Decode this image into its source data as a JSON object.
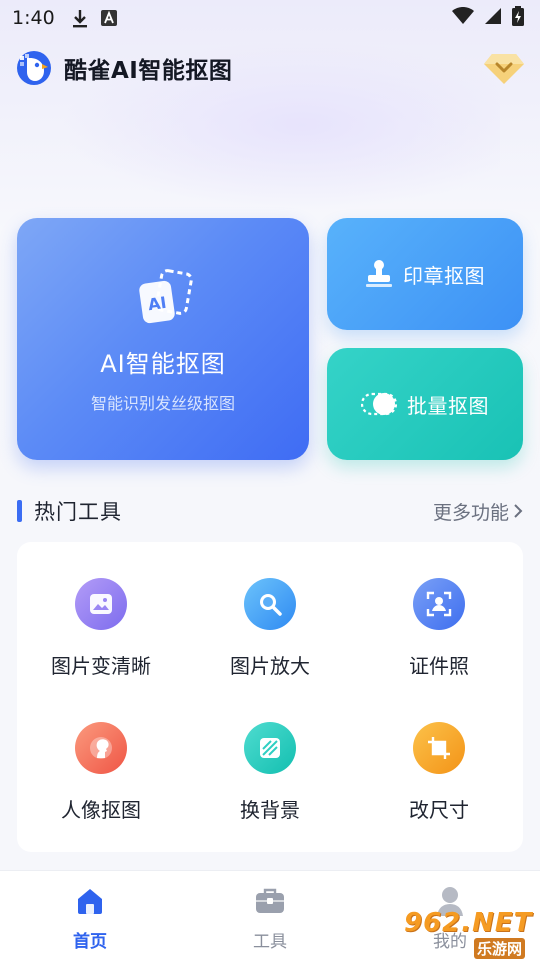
{
  "status_bar": {
    "time": "1:40",
    "left_icons": [
      "download-icon",
      "text-a-icon"
    ],
    "right_icons": [
      "wifi-icon",
      "cellular-icon",
      "battery-icon"
    ]
  },
  "header": {
    "app_title": "酷雀AI智能抠图",
    "logo": "bird-logo-icon",
    "vip_icon": "vip-diamond-icon"
  },
  "feature_cards": {
    "ai": {
      "title": "AI智能抠图",
      "subtitle": "智能识别发丝级抠图",
      "icon": "ai-cards-icon",
      "icon_text": "AI"
    },
    "seal": {
      "label": "印章抠图",
      "icon": "stamp-icon"
    },
    "batch": {
      "label": "批量抠图",
      "icon": "toggle-icon"
    }
  },
  "hot_tools": {
    "title": "热门工具",
    "more_label": "更多功能",
    "items": [
      {
        "label": "图片变清晰",
        "icon": "image-enhance-icon",
        "color": "#8f7cf2"
      },
      {
        "label": "图片放大",
        "icon": "magnifier-icon",
        "color": "#3f9bf4"
      },
      {
        "label": "证件照",
        "icon": "id-photo-icon",
        "color": "#4a7ff1"
      },
      {
        "label": "人像抠图",
        "icon": "portrait-icon",
        "color": "#f36a55"
      },
      {
        "label": "换背景",
        "icon": "background-swap-icon",
        "color": "#22c6b8"
      },
      {
        "label": "改尺寸",
        "icon": "crop-icon",
        "color": "#f7a51d"
      }
    ]
  },
  "bottom_nav": {
    "items": [
      {
        "label": "首页",
        "icon": "home-icon",
        "active": true
      },
      {
        "label": "工具",
        "icon": "toolbox-icon",
        "active": false
      },
      {
        "label": "我的",
        "icon": "profile-icon",
        "active": false
      }
    ]
  },
  "watermark": {
    "big": "962.NET",
    "small": "乐游网"
  },
  "colors": {
    "accent": "#2f63ee",
    "ai_card": "#5c8bf6",
    "seal_card": "#3d91f5",
    "batch_card": "#19c2b5"
  }
}
